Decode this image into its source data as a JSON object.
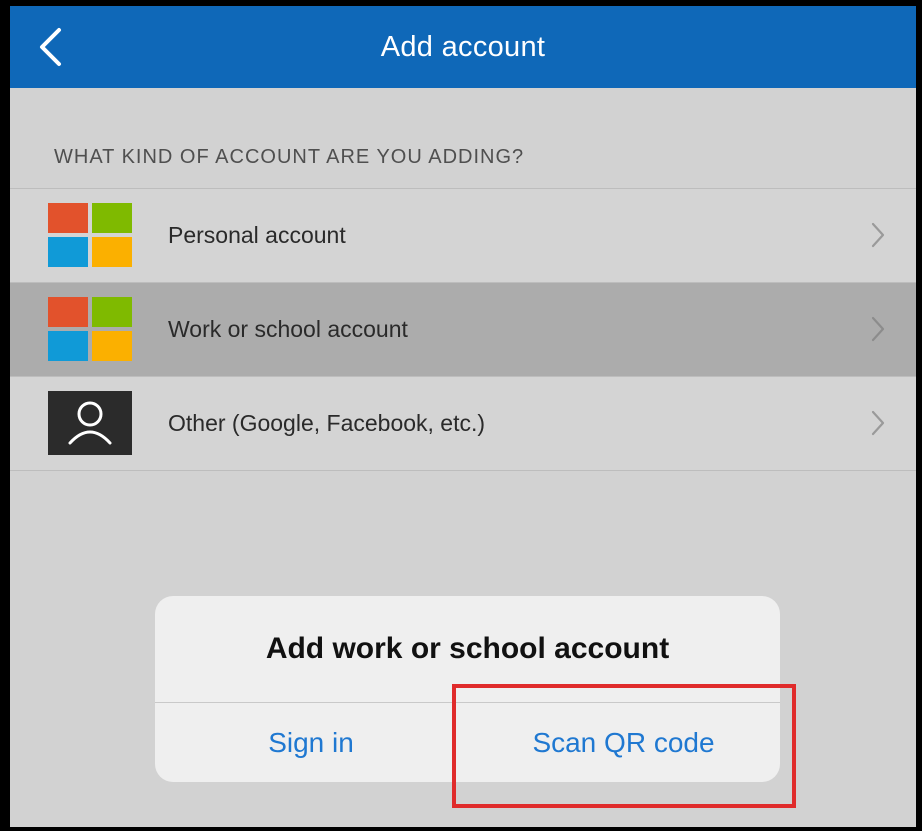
{
  "navbar": {
    "title": "Add account",
    "back_icon": "chevron-left-icon",
    "background_color": "#0f68b8"
  },
  "section_header": "WHAT KIND OF ACCOUNT ARE YOU ADDING?",
  "accounts": [
    {
      "label": "Personal account",
      "icon": "microsoft-logo-icon",
      "selected": false
    },
    {
      "label": "Work or school account",
      "icon": "microsoft-logo-icon",
      "selected": true
    },
    {
      "label": "Other (Google, Facebook, etc.)",
      "icon": "user-icon",
      "selected": false
    }
  ],
  "microsoft_logo_colors": [
    "#e2522c",
    "#7fba00",
    "#109ad7",
    "#fbb000"
  ],
  "dialog": {
    "title": "Add work or school account",
    "sign_in_label": "Sign in",
    "scan_qr_label": "Scan QR code",
    "button_color": "#1f78d1"
  },
  "highlight_color": "#e02b2b"
}
